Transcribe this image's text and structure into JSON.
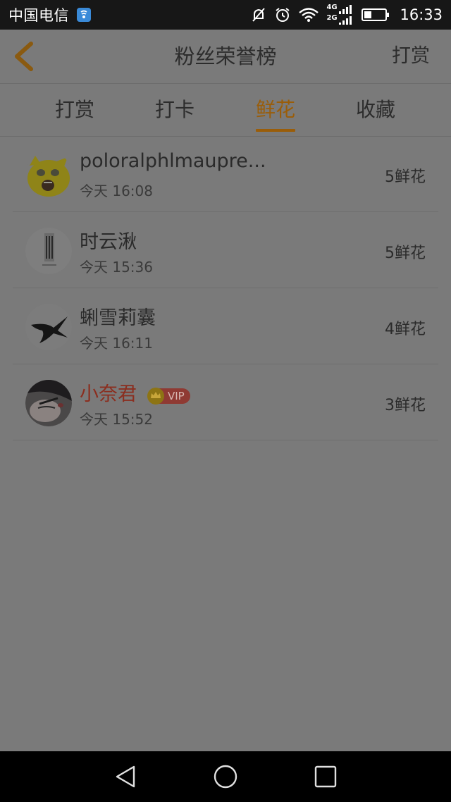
{
  "status_bar": {
    "carrier": "中国电信",
    "time": "16:33",
    "network_top": "4G",
    "network_bottom": "2G",
    "icons": [
      "hd-voice-icon",
      "mute-icon",
      "alarm-icon",
      "wifi-icon",
      "signal-icon",
      "battery-icon"
    ]
  },
  "header": {
    "title": "粉丝荣誉榜",
    "right_action": "打赏",
    "back_icon": "back-chevron-icon"
  },
  "tabs": [
    {
      "label": "打赏",
      "active": false
    },
    {
      "label": "打卡",
      "active": false
    },
    {
      "label": "鲜花",
      "active": true
    },
    {
      "label": "收藏",
      "active": false
    }
  ],
  "colors": {
    "accent": "#9a5d09",
    "vip_name": "#8b2e1f",
    "overlay_background": "#7a7a7a"
  },
  "fans": [
    {
      "name": "poloralphlmaupre...",
      "time": "今天 16:08",
      "count": "5鲜花",
      "vip": false
    },
    {
      "name": "时云湫",
      "time": "今天 15:36",
      "count": "5鲜花",
      "vip": false
    },
    {
      "name": "蜊雪莉囊",
      "time": "今天 16:11",
      "count": "4鲜花",
      "vip": false
    },
    {
      "name": "小奈君",
      "time": "今天 15:52",
      "count": "3鲜花",
      "vip": true,
      "badge": "VIP"
    }
  ],
  "nav_bar": {
    "icons": [
      "nav-back-icon",
      "nav-home-icon",
      "nav-recents-icon"
    ]
  }
}
